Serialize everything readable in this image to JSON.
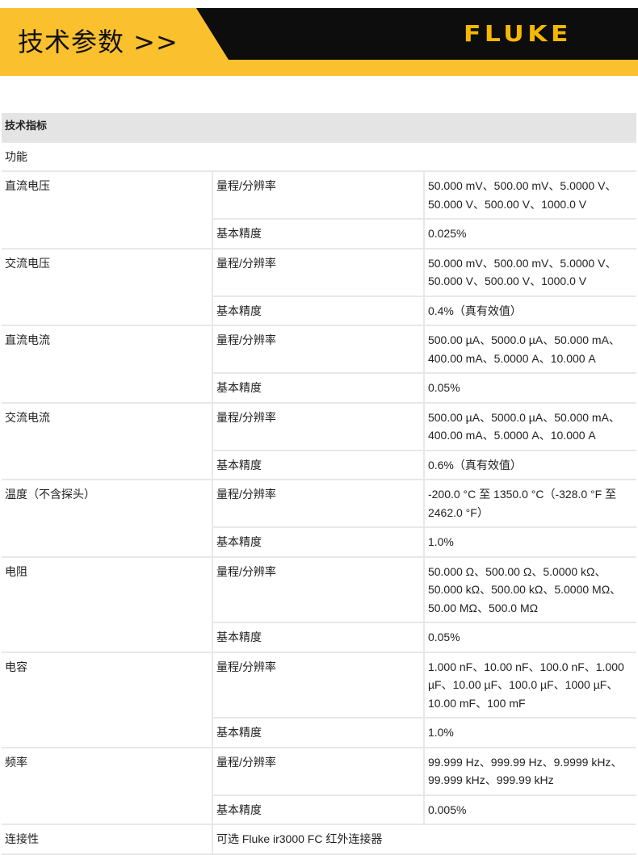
{
  "banner": {
    "title": "技术参数 >>",
    "brand": "FLUKE",
    "colors": {
      "yellow": "#fbc02d",
      "black": "#0d0d0d",
      "brand": "#f5b700"
    }
  },
  "table": {
    "header": "技术指标",
    "section": "功能",
    "rows": [
      {
        "name": "直流电压",
        "range_label": "量程/分辨率",
        "range": "50.000 mV、500.00 mV、5.0000 V、50.000 V、500.00 V、1000.0 V",
        "accuracy_label": "基本精度",
        "accuracy": "0.025%"
      },
      {
        "name": "交流电压",
        "range_label": "量程/分辨率",
        "range": "50.000 mV、500.00 mV、5.0000 V、50.000 V、500.00 V、1000.0 V",
        "accuracy_label": "基本精度",
        "accuracy": "0.4%（真有效值）"
      },
      {
        "name": "直流电流",
        "range_label": "量程/分辨率",
        "range": "500.00 µA、5000.0 µA、50.000 mA、400.00 mA、5.0000 A、10.000 A",
        "accuracy_label": "基本精度",
        "accuracy": "0.05%"
      },
      {
        "name": "交流电流",
        "range_label": "量程/分辨率",
        "range": "500.00 µA、5000.0 µA、50.000 mA、400.00 mA、5.0000 A、10.000 A",
        "accuracy_label": "基本精度",
        "accuracy": "0.6%（真有效值）"
      },
      {
        "name": "温度（不含探头）",
        "range_label": "量程/分辨率",
        "range": "-200.0 °C 至 1350.0 °C（-328.0 °F 至 2462.0 °F）",
        "accuracy_label": "基本精度",
        "accuracy": "1.0%"
      },
      {
        "name": "电阻",
        "range_label": "量程/分辨率",
        "range": "50.000 Ω、500.00 Ω、5.0000 kΩ、50.000 kΩ、500.00 kΩ、5.0000 MΩ、50.00 MΩ、500.0 MΩ",
        "accuracy_label": "基本精度",
        "accuracy": "0.05%"
      },
      {
        "name": "电容",
        "range_label": "量程/分辨率",
        "range": "1.000 nF、10.00 nF、100.0 nF、1.000 µF、10.00 µF、100.0 µF、1000 µF、10.00 mF、100 mF",
        "accuracy_label": "基本精度",
        "accuracy": "1.0%"
      },
      {
        "name": "频率",
        "range_label": "量程/分辨率",
        "range": "99.999 Hz、999.99 Hz、9.9999 kHz、99.999 kHz、999.99 kHz",
        "accuracy_label": "基本精度",
        "accuracy": "0.005%"
      }
    ],
    "connectivity": {
      "name": "连接性",
      "value": "可选 Fluke ir3000 FC 红外连接器"
    }
  }
}
